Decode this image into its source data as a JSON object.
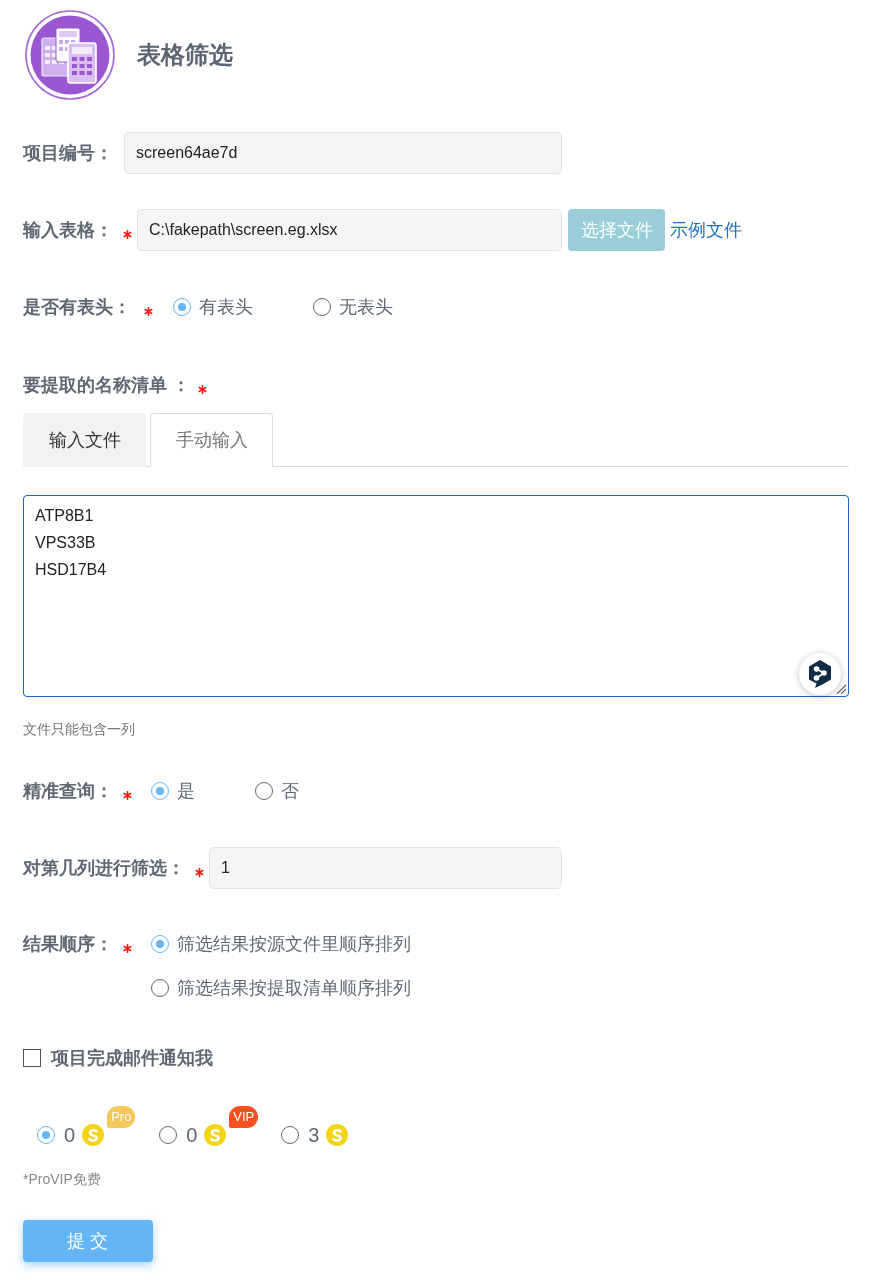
{
  "header": {
    "title": "表格筛选"
  },
  "project_id": {
    "label": "项目编号：",
    "value": "screen64ae7d"
  },
  "input_table": {
    "label": "输入表格：",
    "required": true,
    "value": "C:\\fakepath\\screen.eg.xlsx",
    "button": "选择文件",
    "link": "示例文件"
  },
  "has_header": {
    "label": "是否有表头：",
    "required": true,
    "options": [
      {
        "label": "有表头",
        "selected": true
      },
      {
        "label": "无表头",
        "selected": false
      }
    ]
  },
  "name_list": {
    "label": "要提取的名称清单 ：",
    "required": true,
    "tabs": [
      {
        "label": "输入文件",
        "selected": false
      },
      {
        "label": "手动输入",
        "selected": true
      }
    ],
    "text": "ATP8B1\nVPS33B\nHSD17B4",
    "focused": true,
    "hint": "文件只能包含一列"
  },
  "exact_match": {
    "label": "精准查询：",
    "required": true,
    "options": [
      {
        "label": "是",
        "selected": true
      },
      {
        "label": "否",
        "selected": false
      }
    ]
  },
  "filter_column": {
    "label": "对第几列进行筛选：",
    "required": true,
    "value": "1"
  },
  "result_order": {
    "label": "结果顺序：",
    "required": true,
    "options": [
      {
        "label": "筛选结果按源文件里顺序排列",
        "selected": true
      },
      {
        "label": "筛选结果按提取清单顺序排列",
        "selected": false
      }
    ]
  },
  "email_notify": {
    "label": "项目完成邮件通知我",
    "checked": false
  },
  "pricing": {
    "options": [
      {
        "amount": "0",
        "badge": "Pro",
        "color": "#f5c75a",
        "selected": true
      },
      {
        "amount": "0",
        "badge": "VIP",
        "color": "#f4511e",
        "selected": false
      },
      {
        "amount": "3",
        "selected": false
      }
    ],
    "note": "*ProVIP免费"
  },
  "submit": {
    "label": "提 交"
  }
}
